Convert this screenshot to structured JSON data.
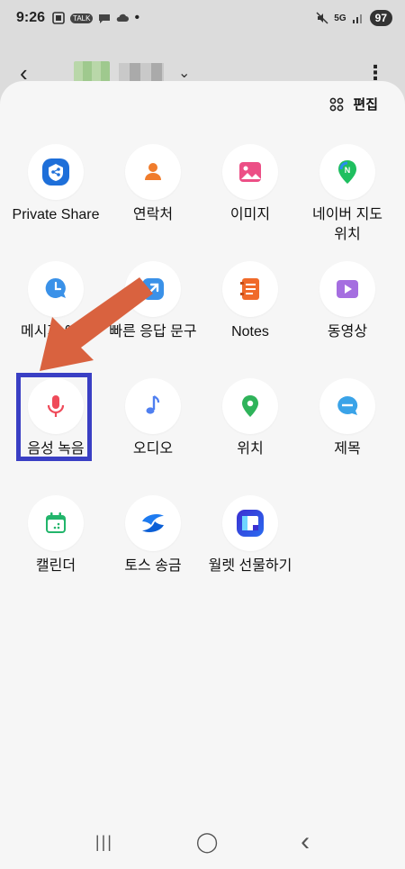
{
  "status": {
    "time": "9:26",
    "talk_badge": "TALK",
    "network": "5G",
    "battery": "97"
  },
  "header": {
    "back": "‹",
    "more": "⋮",
    "chevron": "⌄"
  },
  "sheet": {
    "edit_label": "편집",
    "items": [
      {
        "label": "Private Share",
        "icon": "private-share-icon"
      },
      {
        "label": "연락처",
        "icon": "contacts-icon"
      },
      {
        "label": "이미지",
        "icon": "image-icon"
      },
      {
        "label": "네이버 지도 위치",
        "icon": "naver-map-icon"
      },
      {
        "label": "메시지 예약",
        "icon": "scheduled-message-icon"
      },
      {
        "label": "빠른 응답 문구",
        "icon": "quick-reply-icon"
      },
      {
        "label": "Notes",
        "icon": "notes-icon"
      },
      {
        "label": "동영상",
        "icon": "video-icon"
      },
      {
        "label": "음성 녹음",
        "icon": "voice-record-icon"
      },
      {
        "label": "오디오",
        "icon": "audio-icon"
      },
      {
        "label": "위치",
        "icon": "location-icon"
      },
      {
        "label": "제목",
        "icon": "subject-icon"
      },
      {
        "label": "캘린더",
        "icon": "calendar-icon"
      },
      {
        "label": "토스 송금",
        "icon": "toss-transfer-icon"
      },
      {
        "label": "월렛 선물하기",
        "icon": "wallet-gift-icon"
      }
    ]
  },
  "nav": {
    "recents": "|||",
    "home": "◯",
    "back": "‹"
  },
  "colors": {
    "highlight": "#3a3fc4",
    "arrow": "#d9623f"
  }
}
